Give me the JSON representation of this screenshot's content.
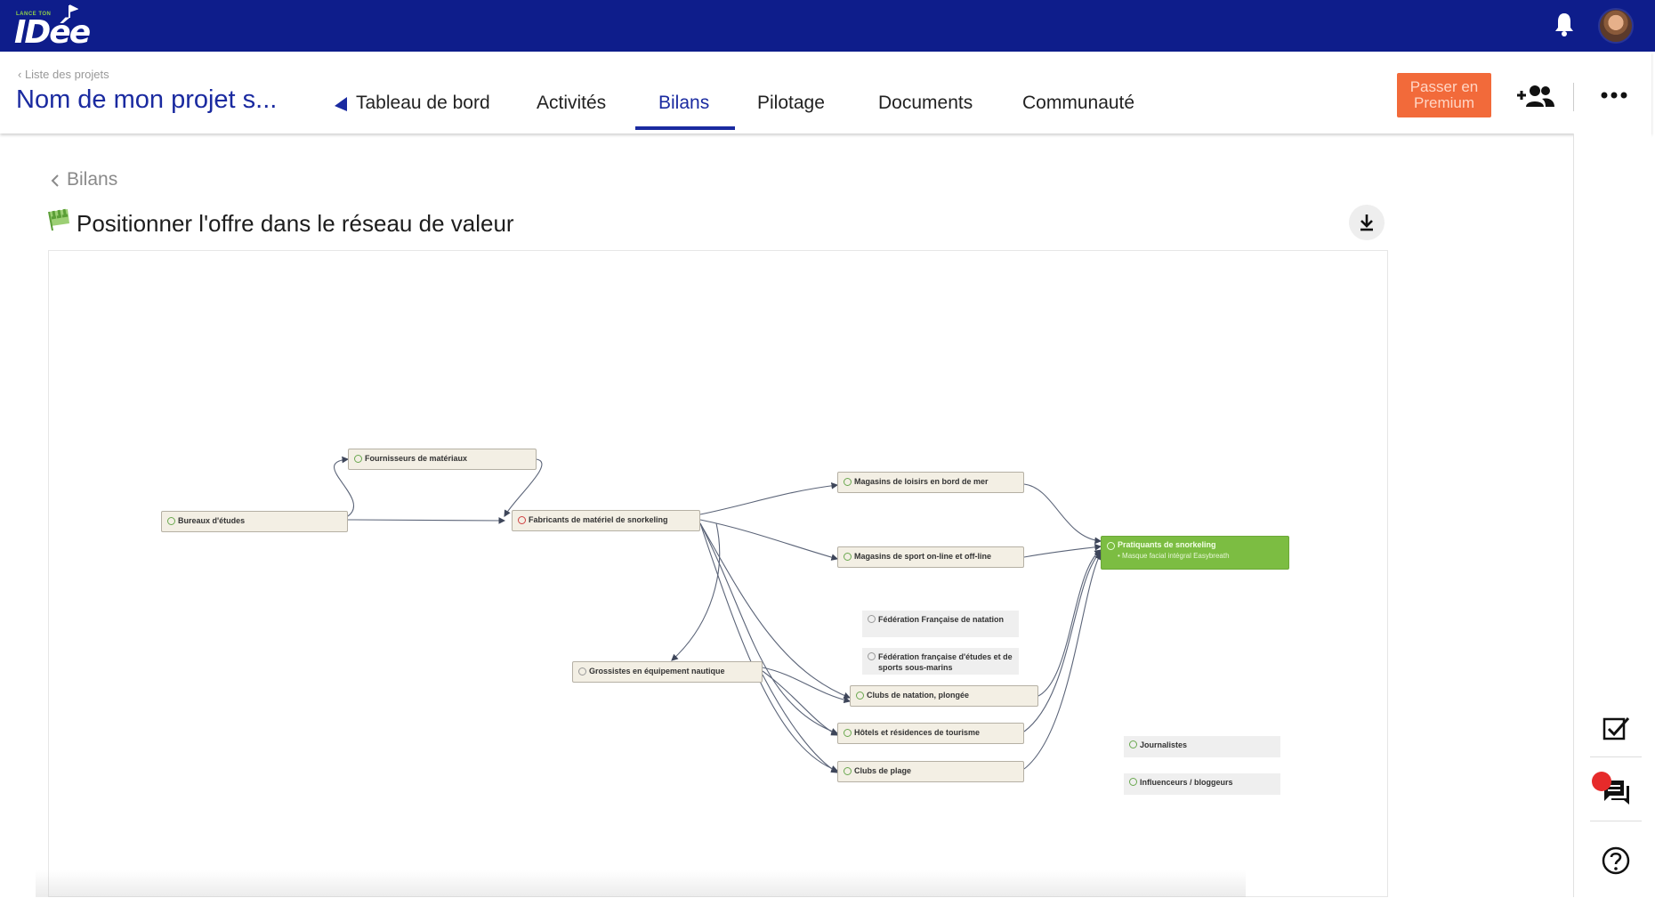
{
  "brand": {
    "tagline": "LANCE TON",
    "wordmark": "IDée",
    "bar_color": "#0e1d8b"
  },
  "project": {
    "back_link": "‹ Liste des projets",
    "name": "Nom de mon projet s..."
  },
  "tabs": [
    {
      "label": "Tableau de bord",
      "active": false,
      "icon": "back-triangle-icon"
    },
    {
      "label": "Activités",
      "active": false
    },
    {
      "label": "Bilans",
      "active": true
    },
    {
      "label": "Pilotage",
      "active": false
    },
    {
      "label": "Documents",
      "active": false
    },
    {
      "label": "Communauté",
      "active": false
    }
  ],
  "header_actions": {
    "premium_label": "Passer en Premium",
    "premium_color": "#f26a3a",
    "add_member_icon": "add-user-icon",
    "more_icon": "more-horizontal-icon"
  },
  "breadcrumb": {
    "label": "Bilans"
  },
  "page": {
    "title": "Positionner l'offre dans le réseau de valeur",
    "download_icon": "download-icon"
  },
  "diagram": {
    "nodes": [
      {
        "id": "bureaux",
        "label": "Bureaux d'études",
        "status": "ok"
      },
      {
        "id": "fournisseurs",
        "label": "Fournisseurs de matériaux",
        "status": "ok"
      },
      {
        "id": "fabricants",
        "label": "Fabricants de matériel de snorkeling",
        "status": "warning"
      },
      {
        "id": "magasins_loisirs",
        "label": "Magasins de loisirs en bord de mer",
        "status": "ok"
      },
      {
        "id": "magasins_sport",
        "label": "Magasins de sport on-line et off-line",
        "status": "ok"
      },
      {
        "id": "pratiquants",
        "label": "Pratiquants de snorkeling",
        "sublabel": "• Masque facial intégral Easybreath",
        "status": "target"
      },
      {
        "id": "grossistes",
        "label": "Grossistes en équipement nautique",
        "status": "neutral"
      },
      {
        "id": "clubs_natation",
        "label": "Clubs de natation, plongée",
        "status": "ok"
      },
      {
        "id": "hotels",
        "label": "Hôtels et résidences de tourisme",
        "status": "ok"
      },
      {
        "id": "clubs_plage",
        "label": "Clubs de plage",
        "status": "ok"
      }
    ],
    "free_nodes": [
      {
        "id": "ffn",
        "label": "Fédération Française de natation",
        "status": "neutral"
      },
      {
        "id": "ffessm",
        "label": "Fédération française d'études et de sports sous-marins",
        "status": "neutral"
      },
      {
        "id": "journalistes",
        "label": "Journalistes",
        "status": "ok"
      },
      {
        "id": "influenceurs",
        "label": "Influenceurs / bloggeurs",
        "status": "ok"
      }
    ],
    "colors": {
      "node_fill": "#f3efe4",
      "target_fill": "#7cbd42",
      "edge": "#5b6478"
    }
  },
  "rail": {
    "icons": [
      "tasks-check-icon",
      "comments-icon",
      "help-icon"
    ]
  }
}
